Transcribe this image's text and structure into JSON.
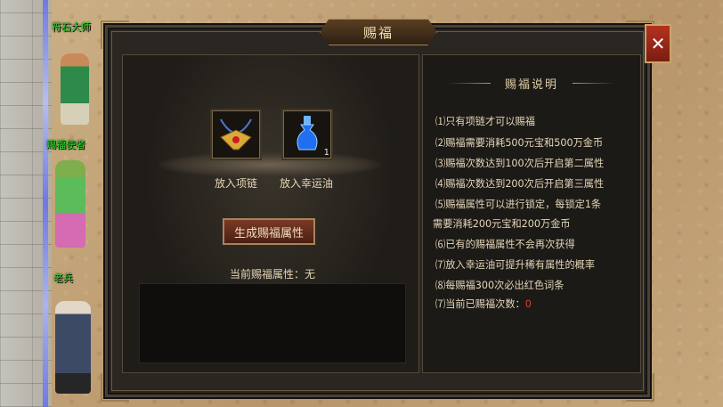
{
  "window": {
    "title": "赐福",
    "close_glyph": "✕"
  },
  "npcs": [
    {
      "name": "符石大师"
    },
    {
      "name": "赐福使者"
    },
    {
      "name": "老兵"
    }
  ],
  "left_panel": {
    "slot1": {
      "label": "放入项链",
      "icon": "necklace-icon"
    },
    "slot2": {
      "label": "放入幸运油",
      "icon": "lucky-oil-bottle-icon",
      "qty": "1"
    },
    "generate_button": "生成赐福属性",
    "current_attr_label": "当前赐福属性：无"
  },
  "right_panel": {
    "heading": "赐福说明",
    "lines": [
      "⑴只有项链才可以赐福",
      "⑵赐福需要消耗500元宝和500万金币",
      "⑶赐福次数达到100次后开启第二属性",
      "⑷赐福次数达到200次后开启第三属性",
      "⑸赐福属性可以进行锁定，每锁定1条",
      "需要消耗200元宝和200万金币",
      "⑹已有的赐福属性不会再次获得",
      "⑺放入幸运油可提升稀有属性的概率",
      "⑻每赐福300次必出红色词条",
      "⑺当前已赐福次数："
    ],
    "count_value": "0"
  },
  "colors": {
    "npc_name": "#29e02a",
    "count_value": "#e23b2d",
    "title_text": "#f2dcb0"
  }
}
